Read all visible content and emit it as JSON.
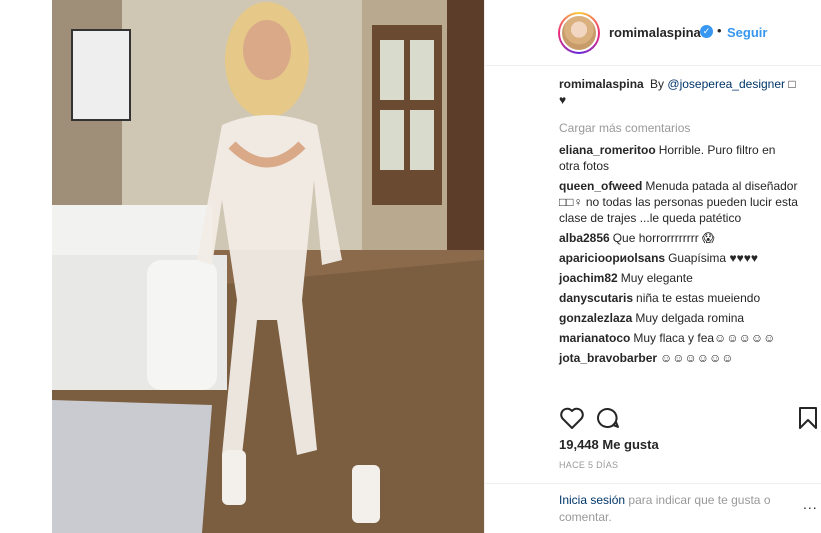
{
  "header": {
    "username": "romimalaspina",
    "verified_badge": "✓",
    "separator": "•",
    "follow_label": "Seguir"
  },
  "caption": {
    "username": "romimalaspina",
    "text": "By",
    "mention": "@joseperea_designer",
    "emoji": "□ ♥"
  },
  "load_more": "Cargar más comentarios",
  "comments": [
    {
      "user": "eliana_romeritoo",
      "text": "Horrible. Puro filtro en otra fotos"
    },
    {
      "user": "queen_ofweed",
      "text": "Menuda patada al diseñador □□♀ no todas las personas pueden lucir esta clase de trajes ...le queda patético"
    },
    {
      "user": "alba2856",
      "text": "Que horrorrrrrrrr 😱"
    },
    {
      "user": "aparicioориolsans",
      "text": "Guapísima ♥♥♥♥"
    },
    {
      "user": "joachim82",
      "text": "Muy elegante"
    },
    {
      "user": "danyscutaris",
      "text": "niña te estas mueiendo"
    },
    {
      "user": "gonzalezlaza",
      "text": "Muy delgada romina"
    },
    {
      "user": "marianatoco",
      "text": "Muy flaca y fea☺☺☺☺☺"
    },
    {
      "user": "jota_bravobarber",
      "text": "☺☺☺☺☺☺"
    }
  ],
  "likes": "19,448 Me gusta",
  "time": "HACE 5 DÍAS",
  "footer": {
    "login": "Inicia sesión",
    "text": "para indicar que te gusta o comentar.",
    "more": "..."
  },
  "icons": {
    "like": "heart-icon",
    "comment": "comment-bubble-icon",
    "save": "bookmark-icon",
    "more": "more-options-icon"
  }
}
